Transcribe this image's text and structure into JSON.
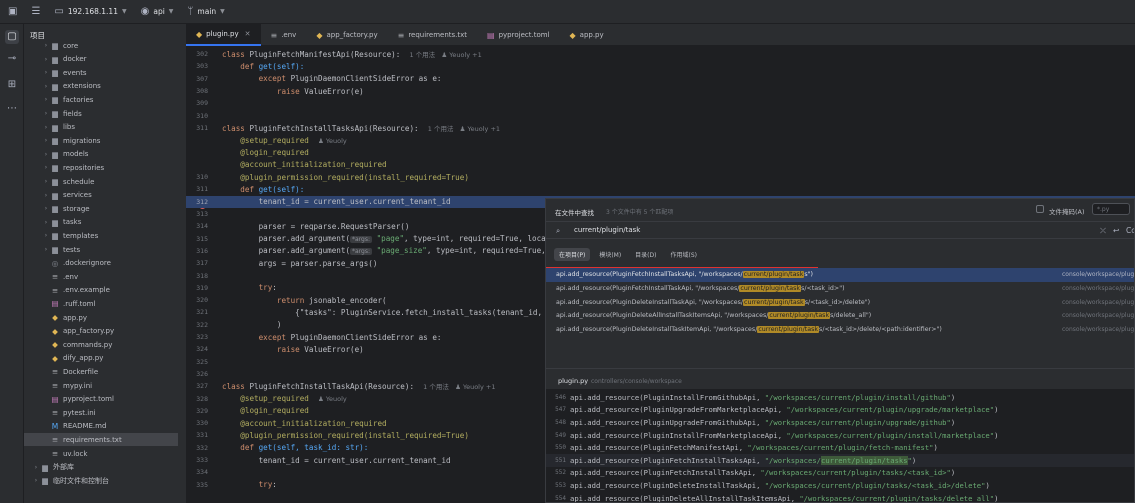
{
  "topbar": {
    "host": "192.168.1.11",
    "project": "api",
    "branch": "main"
  },
  "sidebar": {
    "title": "项目",
    "items": [
      {
        "label": "core",
        "type": "folder",
        "depth": 2,
        "expanded": false
      },
      {
        "label": "docker",
        "type": "folder",
        "depth": 2,
        "expanded": false
      },
      {
        "label": "events",
        "type": "folder",
        "depth": 2,
        "expanded": false
      },
      {
        "label": "extensions",
        "type": "folder",
        "depth": 2,
        "expanded": false
      },
      {
        "label": "factories",
        "type": "folder",
        "depth": 2,
        "expanded": false
      },
      {
        "label": "fields",
        "type": "folder",
        "depth": 2,
        "expanded": false
      },
      {
        "label": "libs",
        "type": "folder",
        "depth": 2,
        "expanded": false
      },
      {
        "label": "migrations",
        "type": "folder",
        "depth": 2,
        "expanded": false
      },
      {
        "label": "models",
        "type": "folder",
        "depth": 2,
        "expanded": false
      },
      {
        "label": "repositories",
        "type": "folder",
        "depth": 2,
        "expanded": false
      },
      {
        "label": "schedule",
        "type": "folder",
        "depth": 2,
        "expanded": false
      },
      {
        "label": "services",
        "type": "folder",
        "depth": 2,
        "expanded": false
      },
      {
        "label": "storage",
        "type": "folder",
        "depth": 2,
        "expanded": false
      },
      {
        "label": "tasks",
        "type": "folder",
        "depth": 2,
        "expanded": false
      },
      {
        "label": "templates",
        "type": "folder",
        "depth": 2,
        "expanded": false
      },
      {
        "label": "tests",
        "type": "folder",
        "depth": 2,
        "expanded": false
      },
      {
        "label": ".dockerignore",
        "type": "git",
        "depth": 2
      },
      {
        "label": ".env",
        "type": "txt",
        "depth": 2
      },
      {
        "label": ".env.example",
        "type": "txt",
        "depth": 2
      },
      {
        "label": ".ruff.toml",
        "type": "toml",
        "depth": 2
      },
      {
        "label": "app.py",
        "type": "py",
        "depth": 2
      },
      {
        "label": "app_factory.py",
        "type": "py",
        "depth": 2
      },
      {
        "label": "commands.py",
        "type": "py",
        "depth": 2
      },
      {
        "label": "dify_app.py",
        "type": "py",
        "depth": 2
      },
      {
        "label": "Dockerfile",
        "type": "txt",
        "depth": 2
      },
      {
        "label": "mypy.ini",
        "type": "txt",
        "depth": 2
      },
      {
        "label": "pyproject.toml",
        "type": "toml",
        "depth": 2
      },
      {
        "label": "pytest.ini",
        "type": "txt",
        "depth": 2
      },
      {
        "label": "README.md",
        "type": "md",
        "depth": 2
      },
      {
        "label": "requirements.txt",
        "type": "txt",
        "depth": 2,
        "selected": true
      },
      {
        "label": "uv.lock",
        "type": "txt",
        "depth": 2
      },
      {
        "label": "外部库",
        "type": "folder",
        "depth": 1,
        "expanded": false
      },
      {
        "label": "临时文件和控制台",
        "type": "folder",
        "depth": 1,
        "expanded": false
      }
    ]
  },
  "tabs": [
    {
      "label": "plugin.py",
      "icon": "py",
      "active": true
    },
    {
      "label": ".env",
      "icon": "txt"
    },
    {
      "label": "app_factory.py",
      "icon": "py"
    },
    {
      "label": "requirements.txt",
      "icon": "txt"
    },
    {
      "label": "pyproject.toml",
      "icon": "toml"
    },
    {
      "label": "app.py",
      "icon": "py"
    }
  ],
  "editor": {
    "lines": [
      {
        "n": "302",
        "t": "class_def",
        "name": "PluginFetchManifestApi",
        "base": "Resource",
        "hint": "1 个用法   ♟ Yeuoly +1"
      },
      {
        "n": "303",
        "t": "def",
        "indent": 1,
        "code": "def get(self):"
      },
      {
        "n": "307",
        "t": "plain",
        "indent": 2,
        "kw": "except",
        "code": " PluginDaemonClientSideError as e:"
      },
      {
        "n": "308",
        "t": "plain",
        "indent": 3,
        "kw": "raise",
        "code": " ValueError(e)"
      },
      {
        "n": "309",
        "t": "blank"
      },
      {
        "n": "310",
        "t": "blank"
      },
      {
        "n": "311",
        "t": "class_def",
        "name": "PluginFetchInstallTasksApi",
        "base": "Resource",
        "hint": "1 个用法   ♟ Yeuoly +1"
      },
      {
        "n": "",
        "t": "decorator",
        "indent": 1,
        "code": "@setup_required",
        "hint": "♟ Yeuoly"
      },
      {
        "n": "",
        "t": "decorator",
        "indent": 1,
        "code": "@login_required"
      },
      {
        "n": "",
        "t": "decorator",
        "indent": 1,
        "code": "@account_initialization_required"
      },
      {
        "n": "310",
        "t": "decorator",
        "indent": 1,
        "code": "@plugin_permission_required(install_required=True)"
      },
      {
        "n": "311",
        "t": "def",
        "indent": 1,
        "code": "def get(self):"
      },
      {
        "n": "312",
        "t": "current",
        "indent": 2,
        "code": "tenant_id = current_user.current_tenant_id"
      },
      {
        "n": "313",
        "t": "blank"
      },
      {
        "n": "314",
        "t": "plain",
        "indent": 2,
        "code": "parser = reqparse.RequestParser()"
      },
      {
        "n": "315",
        "t": "arg",
        "indent": 2,
        "pre": "parser.add_argument(",
        "inlay": "*args:",
        "str": "\"page\"",
        "post": ", type=int, required=True, locat"
      },
      {
        "n": "316",
        "t": "arg",
        "indent": 2,
        "pre": "parser.add_argument(",
        "inlay": "*args:",
        "str": "\"page_size\"",
        "post": ", type=int, required=True,"
      },
      {
        "n": "317",
        "t": "plain",
        "indent": 2,
        "code": "args = parser.parse_args()"
      },
      {
        "n": "318",
        "t": "blank"
      },
      {
        "n": "319",
        "t": "plain",
        "indent": 2,
        "kw": "try",
        "code": ":"
      },
      {
        "n": "320",
        "t": "plain",
        "indent": 3,
        "kw": "return",
        "code": " jsonable_encoder("
      },
      {
        "n": "321",
        "t": "plain",
        "indent": 4,
        "code": "{\"tasks\": PluginService.fetch_install_tasks(tenant_id,"
      },
      {
        "n": "322",
        "t": "plain",
        "indent": 3,
        "code": ")"
      },
      {
        "n": "323",
        "t": "plain",
        "indent": 2,
        "kw": "except",
        "code": " PluginDaemonClientSideError as e:"
      },
      {
        "n": "324",
        "t": "plain",
        "indent": 3,
        "kw": "raise",
        "code": " ValueError(e)"
      },
      {
        "n": "325",
        "t": "blank"
      },
      {
        "n": "326",
        "t": "blank"
      },
      {
        "n": "327",
        "t": "class_def",
        "name": "PluginFetchInstallTaskApi",
        "base": "Resource",
        "hint": "1 个用法   ♟ Yeuoly +1"
      },
      {
        "n": "328",
        "t": "decorator",
        "indent": 1,
        "code": "@setup_required",
        "hint": "♟ Yeuoly"
      },
      {
        "n": "329",
        "t": "decorator",
        "indent": 1,
        "code": "@login_required"
      },
      {
        "n": "330",
        "t": "decorator",
        "indent": 1,
        "code": "@account_initialization_required"
      },
      {
        "n": "331",
        "t": "decorator",
        "indent": 1,
        "code": "@plugin_permission_required(install_required=True)"
      },
      {
        "n": "332",
        "t": "def",
        "indent": 1,
        "code": "def get(self, task_id: str):"
      },
      {
        "n": "333",
        "t": "plain",
        "indent": 2,
        "code": "tenant_id = current_user.current_tenant_id"
      },
      {
        "n": "334",
        "t": "blank"
      },
      {
        "n": "335",
        "t": "plain",
        "indent": 2,
        "kw": "try",
        "code": ":"
      }
    ]
  },
  "find": {
    "title": "在文件中查找",
    "subtitle": "3 个文件中有 5 个匹配项",
    "file_mask_label": "文件掩码(A)",
    "file_mask_value": "*.py",
    "query": "current/plugin/task",
    "scopes": [
      {
        "label": "在项目(P)",
        "active": true
      },
      {
        "label": "模块(M)"
      },
      {
        "label": "目录(D)"
      },
      {
        "label": "作用域(S)"
      }
    ],
    "results": [
      {
        "pre": "api.add_resource(PluginFetchInstallTasksApi, \"/workspaces/",
        "match": "current/plugin/task",
        "post": "s\")",
        "path": "console/workspace/plugin.py",
        "selected": true
      },
      {
        "pre": "api.add_resource(PluginFetchInstallTaskApi, \"/workspaces/",
        "match": "current/plugin/task",
        "post": "s/<task_id>\")",
        "path": "console/workspace/plugin.py"
      },
      {
        "pre": "api.add_resource(PluginDeleteInstallTaskApi, \"/workspaces/",
        "match": "current/plugin/task",
        "post": "s/<task_id>/delete\")",
        "path": "console/workspace/plugin.py"
      },
      {
        "pre": "api.add_resource(PluginDeleteAllInstallTaskItemsApi, \"/workspaces/",
        "match": "current/plugin/task",
        "post": "s/delete_all\")",
        "path": "console/workspace/plugin.py"
      },
      {
        "pre": "api.add_resource(PluginDeleteInstallTaskItemApi, \"/workspaces/",
        "match": "current/plugin/task",
        "post": "s/<task_id>/delete/<path:identifier>\")",
        "path": "console/workspace/plugin.py"
      }
    ],
    "preview_file": "plugin.py",
    "preview_path": "controllers/console/workspace",
    "preview": [
      {
        "n": "546",
        "pre": "api.add_resource(PluginInstallFromGithubApi, ",
        "str": "\"/workspaces/current/plugin/install/github\"",
        "post": ")"
      },
      {
        "n": "547",
        "pre": "api.add_resource(PluginUpgradeFromMarketplaceApi, ",
        "str": "\"/workspaces/current/plugin/upgrade/marketplace\"",
        "post": ")"
      },
      {
        "n": "548",
        "pre": "api.add_resource(PluginUpgradeFromGithubApi, ",
        "str": "\"/workspaces/current/plugin/upgrade/github\"",
        "post": ")"
      },
      {
        "n": "549",
        "pre": "api.add_resource(PluginInstallFromMarketplaceApi, ",
        "str": "\"/workspaces/current/plugin/install/marketplace\"",
        "post": ")"
      },
      {
        "n": "550",
        "pre": "api.add_resource(PluginFetchManifestApi, ",
        "str": "\"/workspaces/current/plugin/fetch-manifest\"",
        "post": ")"
      },
      {
        "n": "551",
        "pre": "api.add_resource(PluginFetchInstallTasksApi, ",
        "str_a": "\"/workspaces/",
        "match": "current/plugin/tasks",
        "str_b": "\"",
        "post": ")",
        "current": true
      },
      {
        "n": "552",
        "pre": "api.add_resource(PluginFetchInstallTaskApi, ",
        "str": "\"/workspaces/current/plugin/tasks/<task_id>\"",
        "post": ")"
      },
      {
        "n": "553",
        "pre": "api.add_resource(PluginDeleteInstallTaskApi, ",
        "str": "\"/workspaces/current/plugin/tasks/<task_id>/delete\"",
        "post": ")"
      },
      {
        "n": "554",
        "pre": "api.add_resource(PluginDeleteAllInstallTaskItemsApi, ",
        "str": "\"/workspaces/current/plugin/tasks/delete_all\"",
        "post": ")"
      }
    ]
  },
  "colors": {
    "accent": "#3574f0",
    "match_highlight": "#b08a27",
    "red_annotation": "#e0322f"
  }
}
